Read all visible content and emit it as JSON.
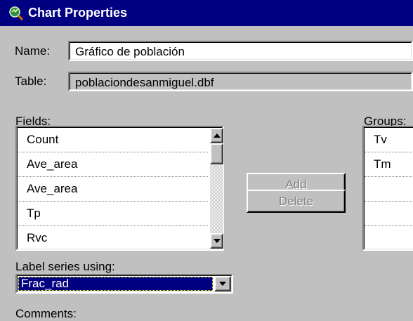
{
  "window": {
    "title": "Chart Properties",
    "icon": "chart-magnifier-icon",
    "title_bar_color": "#000080"
  },
  "name_field": {
    "label": "Name:",
    "value": "Gráfico de población"
  },
  "table_field": {
    "label": "Table:",
    "value": "poblaciondesanmiguel.dbf"
  },
  "fields": {
    "label": "Fields:",
    "items": [
      "Count",
      "Ave_area",
      "Ave_area",
      "Tp",
      "Rvc"
    ]
  },
  "buttons": {
    "add_label": "Add",
    "delete_label": "Delete"
  },
  "groups": {
    "label": "Groups:",
    "items": [
      "Tv",
      "Tm",
      "",
      "",
      ""
    ]
  },
  "label_series": {
    "label": "Label series using:",
    "selected": "Frac_rad"
  },
  "comments": {
    "label": "Comments:"
  }
}
